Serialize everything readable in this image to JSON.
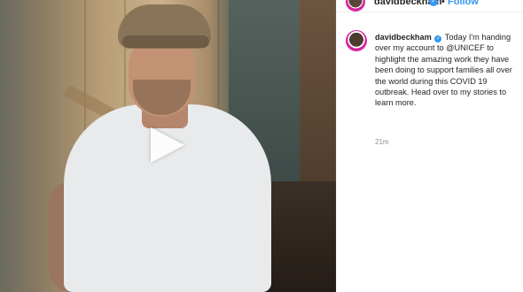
{
  "colors": {
    "brand_blue": "#3897f0",
    "text_primary": "#262626",
    "text_secondary": "#8e8e8e",
    "story_ring": "#d6249f"
  },
  "video": {
    "play_icon": "play-icon"
  },
  "header": {
    "username": "davidbeckham",
    "verified_icon": "verified-badge-icon",
    "separator": "•",
    "follow_label": "Follow"
  },
  "post": {
    "username": "davidbeckham",
    "verified_icon": "verified-badge-icon",
    "caption": "Today I'm handing over my account to @UNICEF to highlight the amazing work they have been doing to support families all over the world during this COVID 19 outbreak. Head over to my stories to learn more.",
    "timestamp": "21m"
  }
}
